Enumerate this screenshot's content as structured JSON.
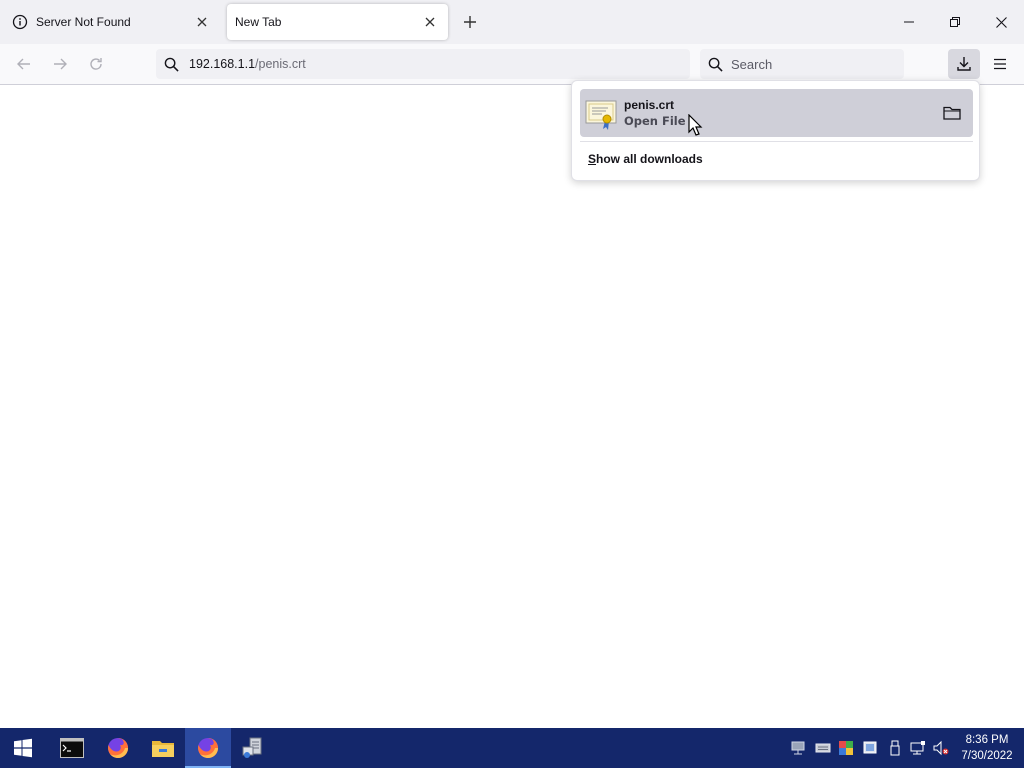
{
  "browser": {
    "tabs": [
      {
        "title": "Server Not Found",
        "active": false
      },
      {
        "title": "New Tab",
        "active": true
      }
    ],
    "url": {
      "host": "192.168.1.1",
      "path": "/penis.crt"
    },
    "search": {
      "placeholder": "Search",
      "value": ""
    },
    "icons": {
      "tab1": "info-icon",
      "tab_close": "close-icon",
      "new_tab": "plus-icon",
      "minimize": "minimize-icon",
      "restore": "restore-icon",
      "close": "close-icon",
      "back": "arrow-left-icon",
      "forward": "arrow-right-icon",
      "reload": "reload-icon",
      "url_search": "search-icon",
      "search": "search-icon",
      "downloads": "download-icon",
      "menu": "hamburger-menu-icon"
    }
  },
  "downloads_panel": {
    "item": {
      "filename": "penis.crt",
      "status": "Open File",
      "file_icon": "certificate-icon",
      "folder_icon": "folder-icon"
    },
    "show_all_first": "S",
    "show_all_rest": "how all downloads"
  },
  "taskbar": {
    "apps": [
      "windows-start-icon",
      "command-prompt-icon",
      "firefox-icon",
      "file-explorer-icon",
      "firefox-icon",
      "server-manager-icon"
    ],
    "tray": [
      "network-icon",
      "keyboard-icon",
      "color-icon",
      "display-icon",
      "usb-icon",
      "monitor-network-icon",
      "volume-muted-icon"
    ],
    "time": "8:36 PM",
    "date": "7/30/2022"
  },
  "colors": {
    "taskbar": "#14276b",
    "tab_strip": "#f0f0f4",
    "download_item_hover": "#cfcfd8"
  }
}
